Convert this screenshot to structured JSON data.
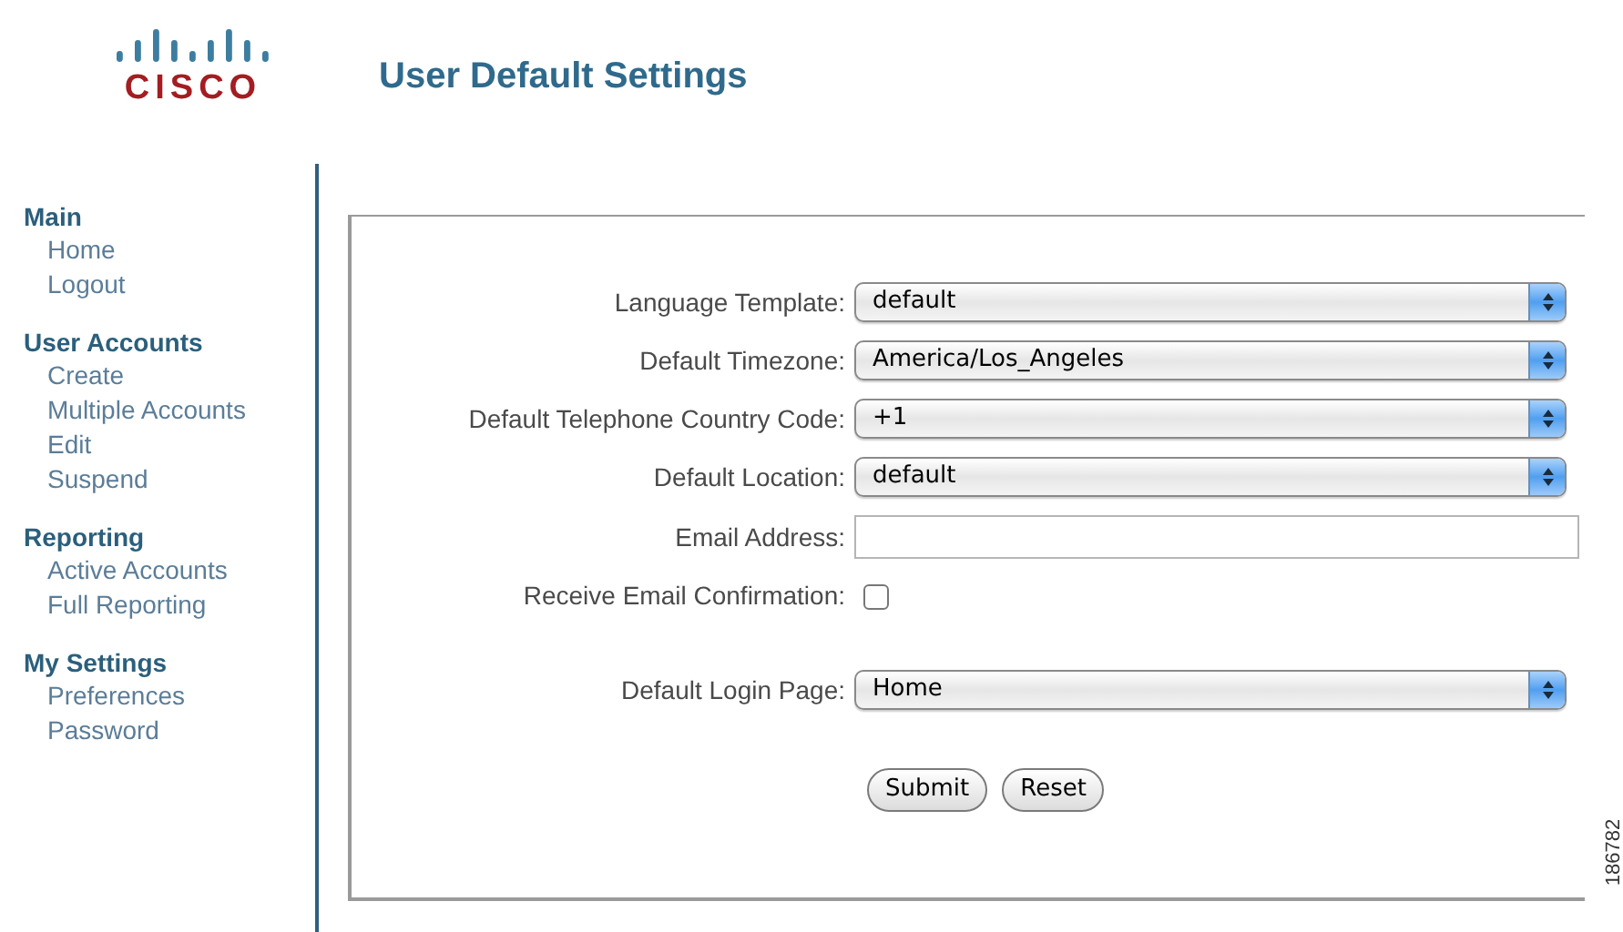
{
  "header": {
    "logo": "CISCO",
    "title": "User Default Settings"
  },
  "sidebar": [
    {
      "heading": "Main",
      "items": [
        "Home",
        "Logout"
      ]
    },
    {
      "heading": "User Accounts",
      "items": [
        "Create",
        "Multiple Accounts",
        "Edit",
        "Suspend"
      ]
    },
    {
      "heading": "Reporting",
      "items": [
        "Active Accounts",
        "Full Reporting"
      ]
    },
    {
      "heading": "My Settings",
      "items": [
        "Preferences",
        "Password"
      ]
    }
  ],
  "form": {
    "fields": [
      {
        "kind": "select",
        "label": "Language Template:",
        "value": "default"
      },
      {
        "kind": "select",
        "label": "Default Timezone:",
        "value": "America/Los_Angeles"
      },
      {
        "kind": "select",
        "label": "Default Telephone Country Code:",
        "value": "+1"
      },
      {
        "kind": "select",
        "label": "Default Location:",
        "value": "default"
      },
      {
        "kind": "text",
        "label": "Email Address:"
      },
      {
        "kind": "checkbox",
        "label": "Receive Email Confirmation:",
        "checked": false
      },
      {
        "kind": "select",
        "label": "Default Login Page:",
        "value": "Home"
      }
    ],
    "buttons": [
      "Submit",
      "Reset"
    ]
  },
  "figure_number": "186782"
}
